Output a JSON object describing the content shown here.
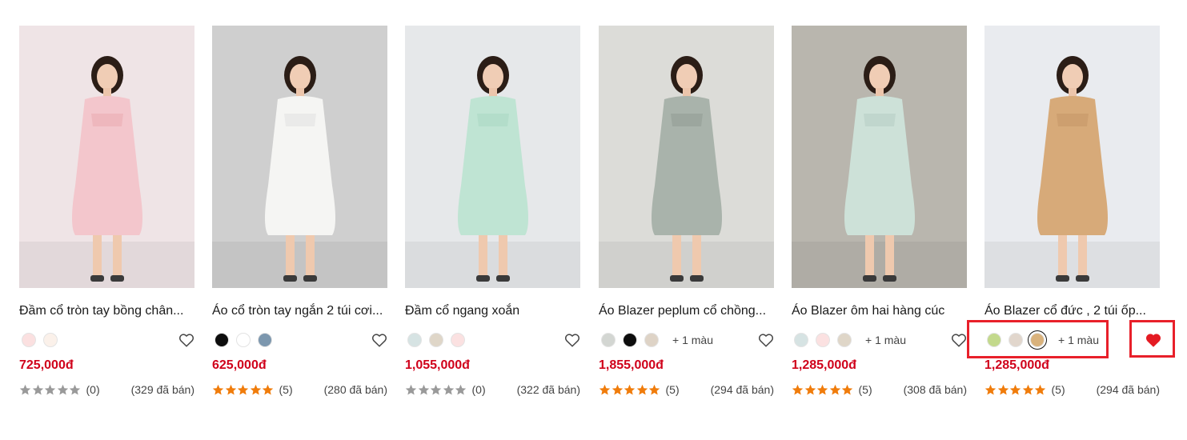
{
  "products": [
    {
      "title": "Đầm cổ tròn tay bồng chân...",
      "price": "725,000đ",
      "reviews": "(0)",
      "sold": "(329 đã bán)",
      "rating": 0,
      "colors": [
        "#fbe0e0",
        "#fbf1ea"
      ],
      "more_colors": "",
      "wishlisted": false,
      "photo_bg": "#efe4e6",
      "outfit": "#f3c6cc",
      "accent": "#e9a8ae"
    },
    {
      "title": "Áo cổ tròn tay ngắn 2 túi cơi...",
      "price": "625,000đ",
      "reviews": "(5)",
      "sold": "(280 đã bán)",
      "rating": 5,
      "colors": [
        "#0d0d0d",
        "#ffffff",
        "#7c97ae"
      ],
      "more_colors": "",
      "wishlisted": false,
      "photo_bg": "#cfcfcf",
      "outfit": "#f5f5f3",
      "accent": "#e0e0e0"
    },
    {
      "title": "Đầm cổ ngang xoắn",
      "price": "1,055,000đ",
      "reviews": "(0)",
      "sold": "(322 đã bán)",
      "rating": 0,
      "colors": [
        "#d6e3e3",
        "#dfd6c8",
        "#fbe1e1"
      ],
      "more_colors": "",
      "wishlisted": false,
      "photo_bg": "#e6e8ea",
      "outfit": "#bfe4d3",
      "accent": "#a7d6c1"
    },
    {
      "title": "Áo Blazer peplum cổ chồng...",
      "price": "1,855,000đ",
      "reviews": "(5)",
      "sold": "(294 đã bán)",
      "rating": 5,
      "colors": [
        "#d3d6d2",
        "#0d0d0d",
        "#ded3c6"
      ],
      "more_colors": "+ 1 màu",
      "wishlisted": false,
      "photo_bg": "#dcdcd8",
      "outfit": "#a9b3ab",
      "accent": "#8f9a92"
    },
    {
      "title": "Áo Blazer ôm hai hàng cúc",
      "price": "1,285,000đ",
      "reviews": "(5)",
      "sold": "(308 đã bán)",
      "rating": 5,
      "colors": [
        "#d6e3e3",
        "#fbe1e1",
        "#dfd6c8"
      ],
      "more_colors": "+ 1 màu",
      "wishlisted": false,
      "photo_bg": "#b9b6ae",
      "outfit": "#cde1d8",
      "accent": "#b4ccc2"
    },
    {
      "title": "Áo Blazer cổ đức , 2 túi ốp...",
      "price": "1,285,000đ",
      "reviews": "(5)",
      "sold": "(294 đã bán)",
      "rating": 5,
      "colors": [
        "#c3d98c",
        "#e1d6cc",
        "#d9b27c"
      ],
      "more_colors": "+ 1 màu",
      "wishlisted": true,
      "photo_bg": "#e9ebef",
      "outfit": "#d7aa79",
      "accent": "#c49466"
    }
  ],
  "theme": {
    "price_color": "#d0021b",
    "star_filled": "#f07c0b",
    "star_empty": "#9a9a9a",
    "heart_filled": "#e41b23",
    "highlight": "#e8202a"
  }
}
